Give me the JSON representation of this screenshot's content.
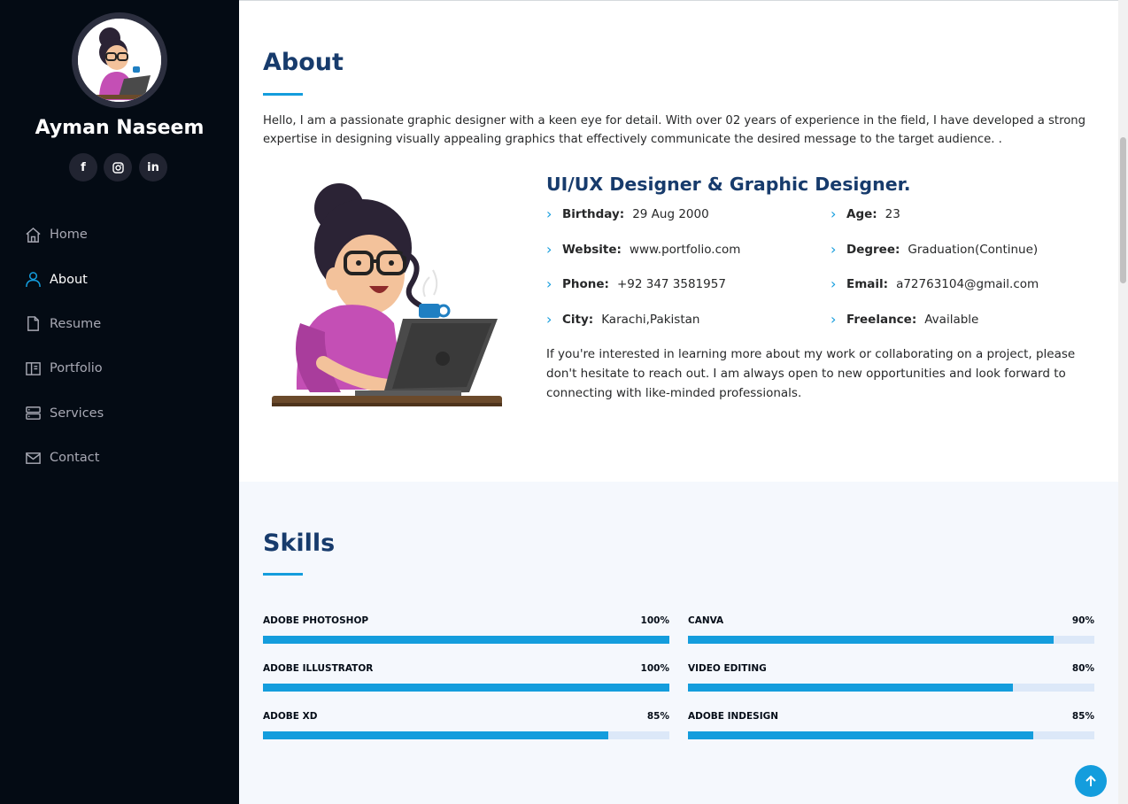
{
  "profile": {
    "name": "Ayman Naseem"
  },
  "social": [
    {
      "icon": "facebook-icon",
      "glyph": "f"
    },
    {
      "icon": "instagram-icon",
      "glyph": "◎"
    },
    {
      "icon": "linkedin-icon",
      "glyph": "in"
    }
  ],
  "nav": {
    "home": "Home",
    "about": "About",
    "resume": "Resume",
    "portfolio": "Portfolio",
    "services": "Services",
    "contact": "Contact"
  },
  "about": {
    "title": "About",
    "intro": "Hello, I am a passionate graphic designer with a keen eye for detail. With over 02 years of experience in the field, I have developed a strong expertise in designing visually appealing graphics that effectively communicate the desired message to the target audience. .",
    "role": "UI/UX Designer & Graphic Designer.",
    "info": {
      "birthday": {
        "label": "Birthday:",
        "value": "29 Aug 2000"
      },
      "website": {
        "label": "Website:",
        "value": "www.portfolio.com"
      },
      "phone": {
        "label": "Phone:",
        "value": "+92 347 3581957"
      },
      "city": {
        "label": "City:",
        "value": "Karachi,Pakistan"
      },
      "age": {
        "label": "Age:",
        "value": "23"
      },
      "degree": {
        "label": "Degree:",
        "value": "Graduation(Continue)"
      },
      "email": {
        "label": "Email:",
        "value": "a72763104@gmail.com"
      },
      "freelance": {
        "label": "Freelance:",
        "value": "Available"
      }
    },
    "outro": "If you're interested in learning more about my work or collaborating on a project, please don't hesitate to reach out. I am always open to new opportunities and look forward to connecting with like-minded professionals."
  },
  "skills": {
    "title": "Skills",
    "items": [
      {
        "name": "ADOBE PHOTOSHOP",
        "percent_label": "100%",
        "percent": 100
      },
      {
        "name": "ADOBE ILLUSTRATOR",
        "percent_label": "100%",
        "percent": 100
      },
      {
        "name": "ADOBE XD",
        "percent_label": "85%",
        "percent": 85
      },
      {
        "name": "CANVA",
        "percent_label": "90%",
        "percent": 90
      },
      {
        "name": "VIDEO EDITING",
        "percent_label": "80%",
        "percent": 80
      },
      {
        "name": "ADOBE INDESIGN",
        "percent_label": "85%",
        "percent": 85
      }
    ]
  },
  "colors": {
    "sidebar_bg": "#040b14",
    "accent": "#149ddd",
    "heading": "#173b6c",
    "skills_bg": "#f5f8fd"
  }
}
